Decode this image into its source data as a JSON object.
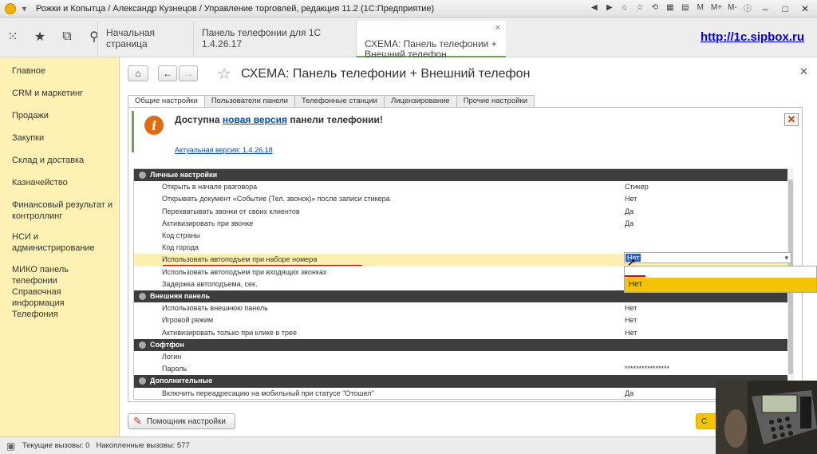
{
  "window": {
    "title": "Рожки и Копытца / Александр Кузнецов / Управление торговлей, редакция 11.2  (1С:Предприятие)",
    "title_buttons": [
      "M",
      "M+",
      "M-"
    ]
  },
  "tabs": [
    {
      "label": "Начальная страница",
      "active": false
    },
    {
      "label": "Панель телефонии для 1С 1.4.26.17",
      "active": false
    },
    {
      "label": "СХЕМА: Панель телефонии +\nВнешний телефон",
      "active": true
    }
  ],
  "site_link": "http://1c.sipbox.ru",
  "sidebar": {
    "items": [
      "Главное",
      "CRM и маркетинг",
      "Продажи",
      "Закупки",
      "Склад и доставка",
      "Казначейство",
      "Финансовый результат и контроллинг",
      "НСИ и администрирование",
      "МИКО панель телефонии",
      "Справочная информация",
      "Телефония"
    ]
  },
  "page": {
    "title": "СХЕМА: Панель телефонии + Внешний телефон"
  },
  "form_tabs": [
    "Общие настройки",
    "Пользователи панели",
    "Телефонные станции",
    "Лицензирование",
    "Прочие настройки"
  ],
  "notice": {
    "prefix": "Доступна ",
    "link": "новая версия",
    "suffix": " панели телефонии!",
    "version": "Актуальная версия: 1.4.26.18"
  },
  "settings": {
    "personal_header": "Личные настройки",
    "personal": [
      {
        "name": "Открыть в начале разговора",
        "value": "Стикер"
      },
      {
        "name": "Открывать документ «Событие (Тел. звонок)» после записи стикера",
        "value": "Нет"
      },
      {
        "name": "Перехватывать звонки от своих клиентов",
        "value": "Да"
      },
      {
        "name": "Активизировать при звонке",
        "value": "Да"
      },
      {
        "name": "Код страны",
        "value": ""
      },
      {
        "name": "Код города",
        "value": ""
      },
      {
        "name": "Использовать автоподъем при наборе номера",
        "value": ""
      },
      {
        "name": "Использовать автоподъем при входящих звонках",
        "value": ""
      },
      {
        "name": "Задержка автоподъема, сек.",
        "value": ""
      }
    ],
    "external_header": "Внешняя панель",
    "external": [
      {
        "name": "Использовать внешнюю панель",
        "value": "Нет"
      },
      {
        "name": "Игровой режим",
        "value": "Нет"
      },
      {
        "name": "Активизировать только при клике в трее",
        "value": "Нет"
      }
    ],
    "softphone_header": "Софтфон",
    "softphone": [
      {
        "name": "Логин",
        "value": ""
      },
      {
        "name": "Пароль",
        "value": "****************"
      }
    ],
    "extra_header": "Дополнительные",
    "extra": [
      {
        "name": "Включить переадресацию на мобильный при статусе \"Отошел\"",
        "value": "Да"
      }
    ]
  },
  "dropdown": {
    "current": "Нет",
    "options": [
      "Нет"
    ]
  },
  "buttons": {
    "helper": "Помощник настройки",
    "ok_partial": "С"
  },
  "status": {
    "current_calls": "Текущие вызовы: 0",
    "total_calls": "Накопленные вызовы: 577"
  },
  "colors": {
    "sidebar_bg": "#fdf2b3",
    "section_bg": "#3d3d3d",
    "highlight_row": "#fdf0b0",
    "accent_yellow": "#f5c400",
    "link": "#0b4db3"
  }
}
